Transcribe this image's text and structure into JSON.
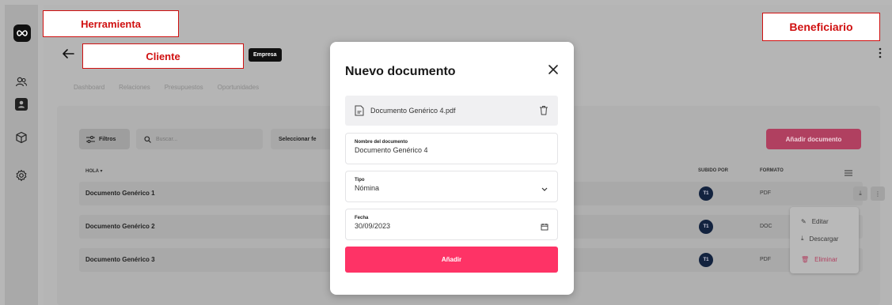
{
  "annotations": {
    "herramienta": "Herramienta",
    "cliente": "Cliente",
    "beneficiario": "Beneficiario"
  },
  "sidebar": {
    "items": [
      {
        "icon": "logo-infinity-icon"
      },
      {
        "icon": "users-icon"
      },
      {
        "icon": "contact-card-icon"
      },
      {
        "icon": "box-icon"
      },
      {
        "icon": "settings-gear-icon"
      }
    ]
  },
  "header": {
    "badge": "Empresa"
  },
  "tabs": [
    {
      "label": "Dashboard"
    },
    {
      "label": "Relaciones"
    },
    {
      "label": "Presupuestos"
    },
    {
      "label": "Oportunidades"
    }
  ],
  "toolbar": {
    "filters_label": "Filtros",
    "search_placeholder": "Buscar...",
    "date_select_label": "Seleccionar fe",
    "add_document_label": "Añadir documento"
  },
  "table": {
    "columns": {
      "name": "HOLA",
      "uploaded_by": "SUBIDO POR",
      "format": "FORMATO"
    },
    "rows": [
      {
        "name": "Documento Genérico 1",
        "avatar": "T1",
        "format": "PDF"
      },
      {
        "name": "Documento Genérico 2",
        "avatar": "T1",
        "format": "DOC"
      },
      {
        "name": "Documento Genérico 3",
        "avatar": "T1",
        "format": "PDF"
      }
    ]
  },
  "context_menu": {
    "edit": "Editar",
    "download": "Descargar",
    "delete": "Eliminar"
  },
  "modal": {
    "title": "Nuevo documento",
    "file_name": "Documento Genérico 4.pdf",
    "name_label": "Nombre del documento",
    "name_value": "Documento Genérico 4",
    "type_label": "Tipo",
    "type_value": "Nómina",
    "date_label": "Fecha",
    "date_value": "30/09/2023",
    "submit_label": "Añadir"
  },
  "colors": {
    "accent": "#fe3366",
    "avatar": "#13233f",
    "annotation": "#d01010"
  }
}
